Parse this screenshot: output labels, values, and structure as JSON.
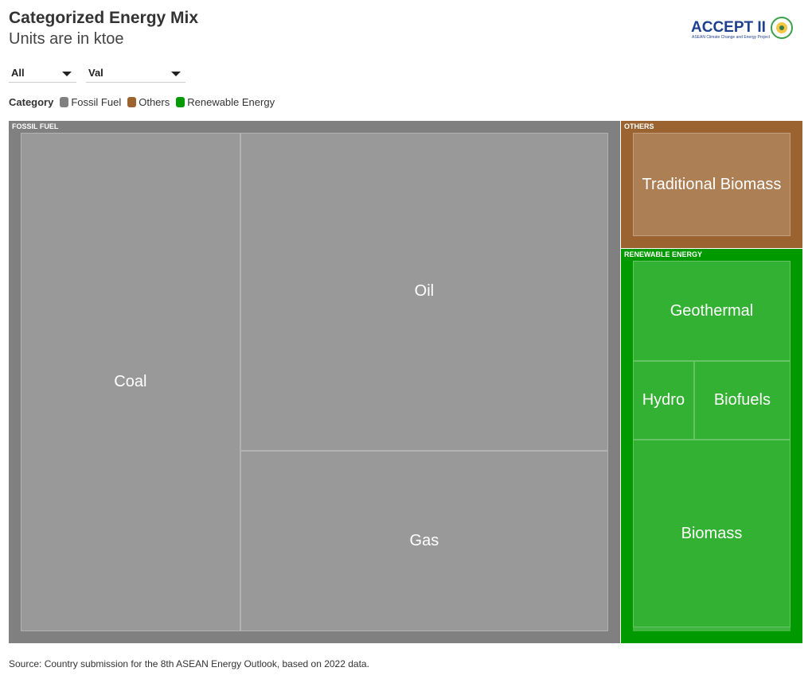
{
  "title": "Categorized Energy Mix",
  "subtitle": "Units are in ktoe",
  "filters": {
    "country": "All",
    "measure": "Val"
  },
  "logo": {
    "text": "ACCEPT II",
    "tagline": "ASEAN Climate Change and Energy Project"
  },
  "source": "Source: Country submission for the 8th ASEAN Energy Outlook, based on 2022 data.",
  "chart_data": {
    "type": "treemap",
    "legend_title": "Category",
    "legend_position": "top-left",
    "categories": [
      {
        "name": "Fossil Fuel",
        "header": "FOSSIL FUEL",
        "color": "#808080",
        "leaf_color": "#999999",
        "children": [
          {
            "name": "Coal",
            "value": 173000
          },
          {
            "name": "Oil",
            "value": 185000
          },
          {
            "name": "Gas",
            "value": 105000
          }
        ]
      },
      {
        "name": "Others",
        "header": "OTHERS",
        "color": "#9a6330",
        "leaf_color": "#ad7f55",
        "children": [
          {
            "name": "Traditional Biomass",
            "value": 24000
          }
        ]
      },
      {
        "name": "Renewable Energy",
        "header": "RENEWABLE ENERGY",
        "color": "#009900",
        "leaf_color": "#33b133",
        "children": [
          {
            "name": "Geothermal",
            "value": 25700
          },
          {
            "name": "Hydro",
            "value": 7800
          },
          {
            "name": "Biofuels",
            "value": 12300
          },
          {
            "name": "Biomass",
            "value": 48000
          }
        ]
      }
    ]
  }
}
